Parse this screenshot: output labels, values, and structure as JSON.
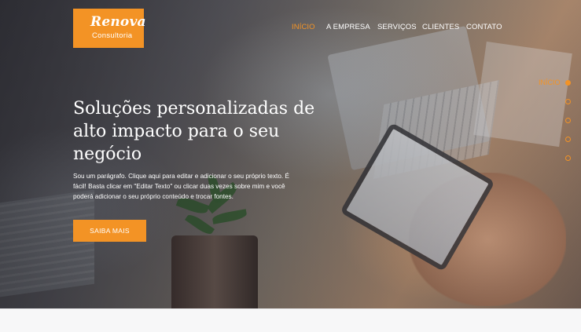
{
  "logo": {
    "main": "Renova",
    "sub": "Consultoria"
  },
  "nav": {
    "items": [
      {
        "label": "INÍCIO",
        "active": true
      },
      {
        "label": "A EMPRESA",
        "active": false
      },
      {
        "label": "SERVIÇOS",
        "active": false
      },
      {
        "label": "CLIENTES",
        "active": false
      },
      {
        "label": "CONTATO",
        "active": false
      }
    ]
  },
  "hero": {
    "headline": "Soluções personalizadas de alto impacto para o seu negócio",
    "paragraph": "Sou um parágrafo. Clique aqui para editar e adicionar o seu próprio texto. É fácil! Basta clicar em \"Editar Texto\" ou clicar duas vezes sobre mim e você poderá adicionar o seu próprio conteúdo e trocar fontes.",
    "cta_label": "SAIBA MAIS"
  },
  "slide_nav": {
    "active_label": "INÍCIO",
    "count": 5,
    "active_index": 0
  },
  "colors": {
    "accent": "#f39325",
    "text_on_hero": "#ffffff"
  }
}
